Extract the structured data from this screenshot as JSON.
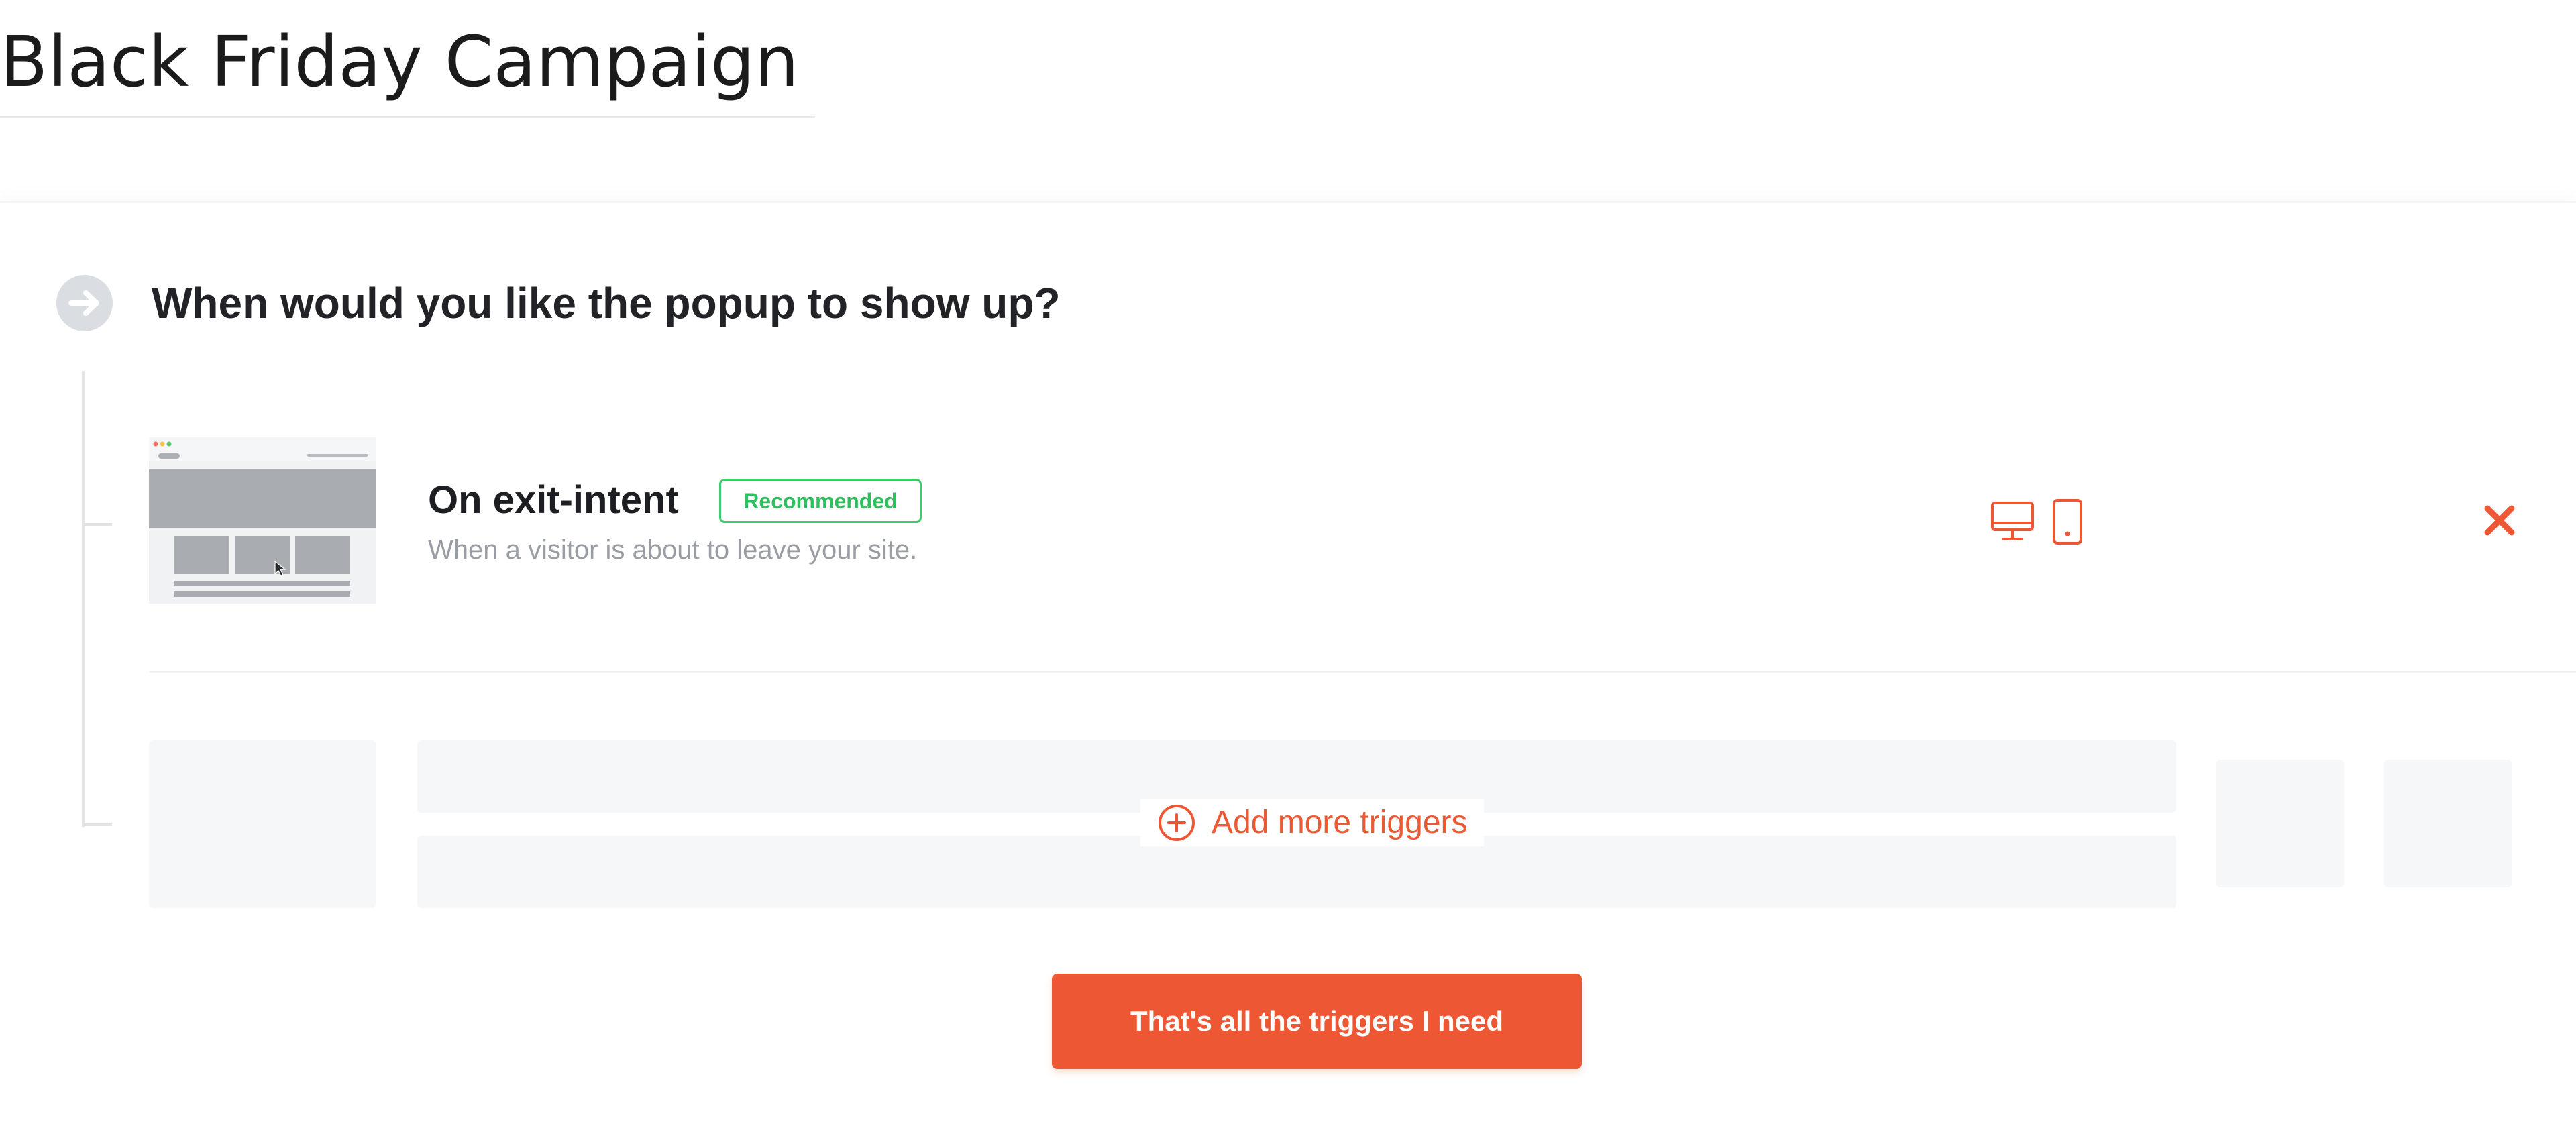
{
  "campaign": {
    "title": "Black Friday Campaign"
  },
  "step": {
    "icon": "arrow-right-circle-icon",
    "question": "When would you like the popup to show up?"
  },
  "triggers": [
    {
      "title": "On exit-intent",
      "badge": "Recommended",
      "description": "When a visitor is about to leave your site.",
      "devices": [
        "desktop-icon",
        "mobile-icon"
      ],
      "remove_icon": "close-icon"
    }
  ],
  "add_triggers": {
    "icon": "plus-circle-icon",
    "label": "Add more triggers"
  },
  "done_button": {
    "label": "That's all the triggers I need"
  },
  "colors": {
    "accent": "#ee5733",
    "recommended": "#3ecb6b",
    "muted_text": "#9a9da3",
    "skeleton": "#f6f7f9",
    "tree_line": "#e1e3e6"
  }
}
